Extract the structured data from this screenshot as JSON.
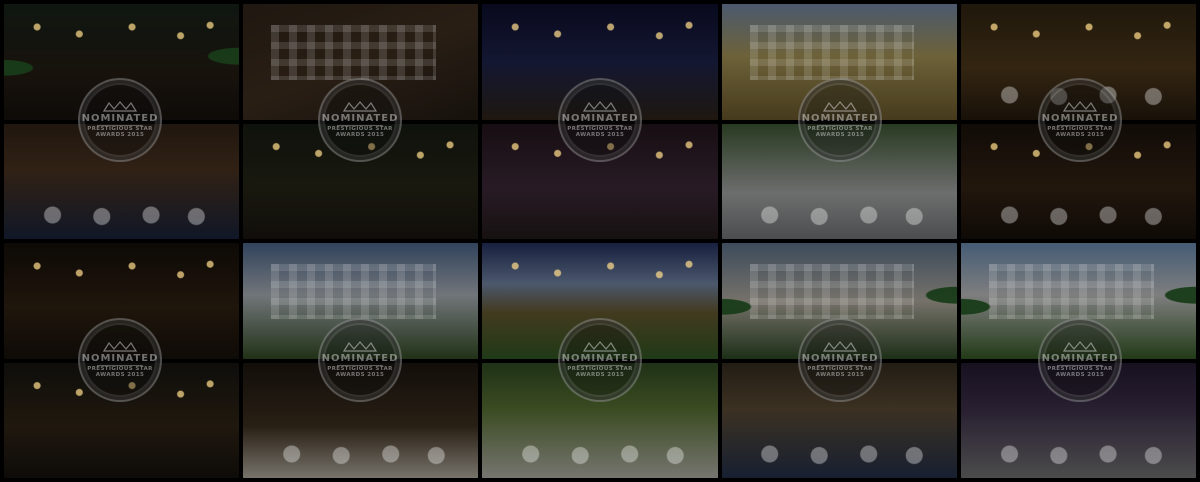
{
  "badge": {
    "top_label": "",
    "main_label": "NOMINATED",
    "sub_label": "PRESTIGIOUS STAR",
    "year_label": "AWARDS 2015"
  },
  "tiles": [
    {
      "name": "garden-restaurant-photo"
    },
    {
      "name": "brick-courtyard-photo"
    },
    {
      "name": "night-monument-photo"
    },
    {
      "name": "yellow-hotel-facade-photo"
    },
    {
      "name": "golden-restaurant-lights-photo"
    },
    {
      "name": "wine-bar-interior-photo"
    },
    {
      "name": "evening-courtyard-photo"
    },
    {
      "name": "purple-dining-room-photo"
    },
    {
      "name": "terrace-dining-photo"
    },
    {
      "name": "bar-lounge-photo"
    },
    {
      "name": "busy-bar-photo"
    },
    {
      "name": "white-building-garden-photo"
    },
    {
      "name": "country-house-lawn-photo"
    },
    {
      "name": "apartment-building-photo"
    },
    {
      "name": "white-villa-photo"
    },
    {
      "name": "restaurant-booths-photo"
    },
    {
      "name": "restaurant-tables-photo"
    },
    {
      "name": "garden-tea-table-photo"
    },
    {
      "name": "banquet-hall-photo"
    },
    {
      "name": "cocktail-lounge-photo"
    }
  ],
  "colors": {
    "background": "#000000",
    "badge_text": "#ffffff"
  }
}
